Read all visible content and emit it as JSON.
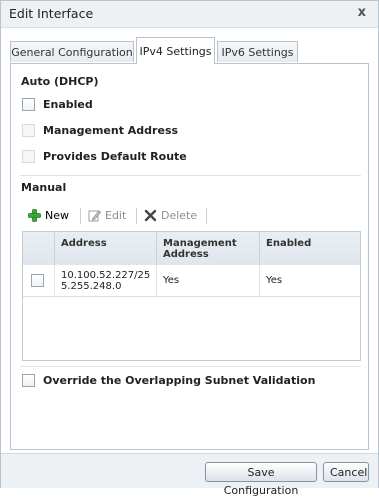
{
  "dialog": {
    "title": "Edit Interface",
    "close_label": "x"
  },
  "tabs": [
    {
      "label": "General Configuration",
      "active": false
    },
    {
      "label": "IPv4 Settings",
      "active": true
    },
    {
      "label": "IPv6 Settings",
      "active": false
    }
  ],
  "auto": {
    "heading": "Auto (DHCP)",
    "enabled_label": "Enabled",
    "management_label": "Management Address",
    "default_route_label": "Provides Default Route"
  },
  "manual": {
    "heading": "Manual",
    "toolbar": {
      "new_label": "New",
      "edit_label": "Edit",
      "delete_label": "Delete"
    },
    "columns": {
      "address": "Address",
      "management": "Management Address",
      "enabled": "Enabled"
    },
    "rows": [
      {
        "address": "10.100.52.227/255.255.248.0",
        "management": "Yes",
        "enabled": "Yes"
      }
    ]
  },
  "override_label": "Override the Overlapping Subnet Validation",
  "footer": {
    "save_label": "Save Configuration",
    "cancel_label": "Cancel"
  },
  "colors": {
    "accent_green": "#3aa835",
    "delete_dark": "#444444",
    "button_border": "#7f96ad"
  }
}
